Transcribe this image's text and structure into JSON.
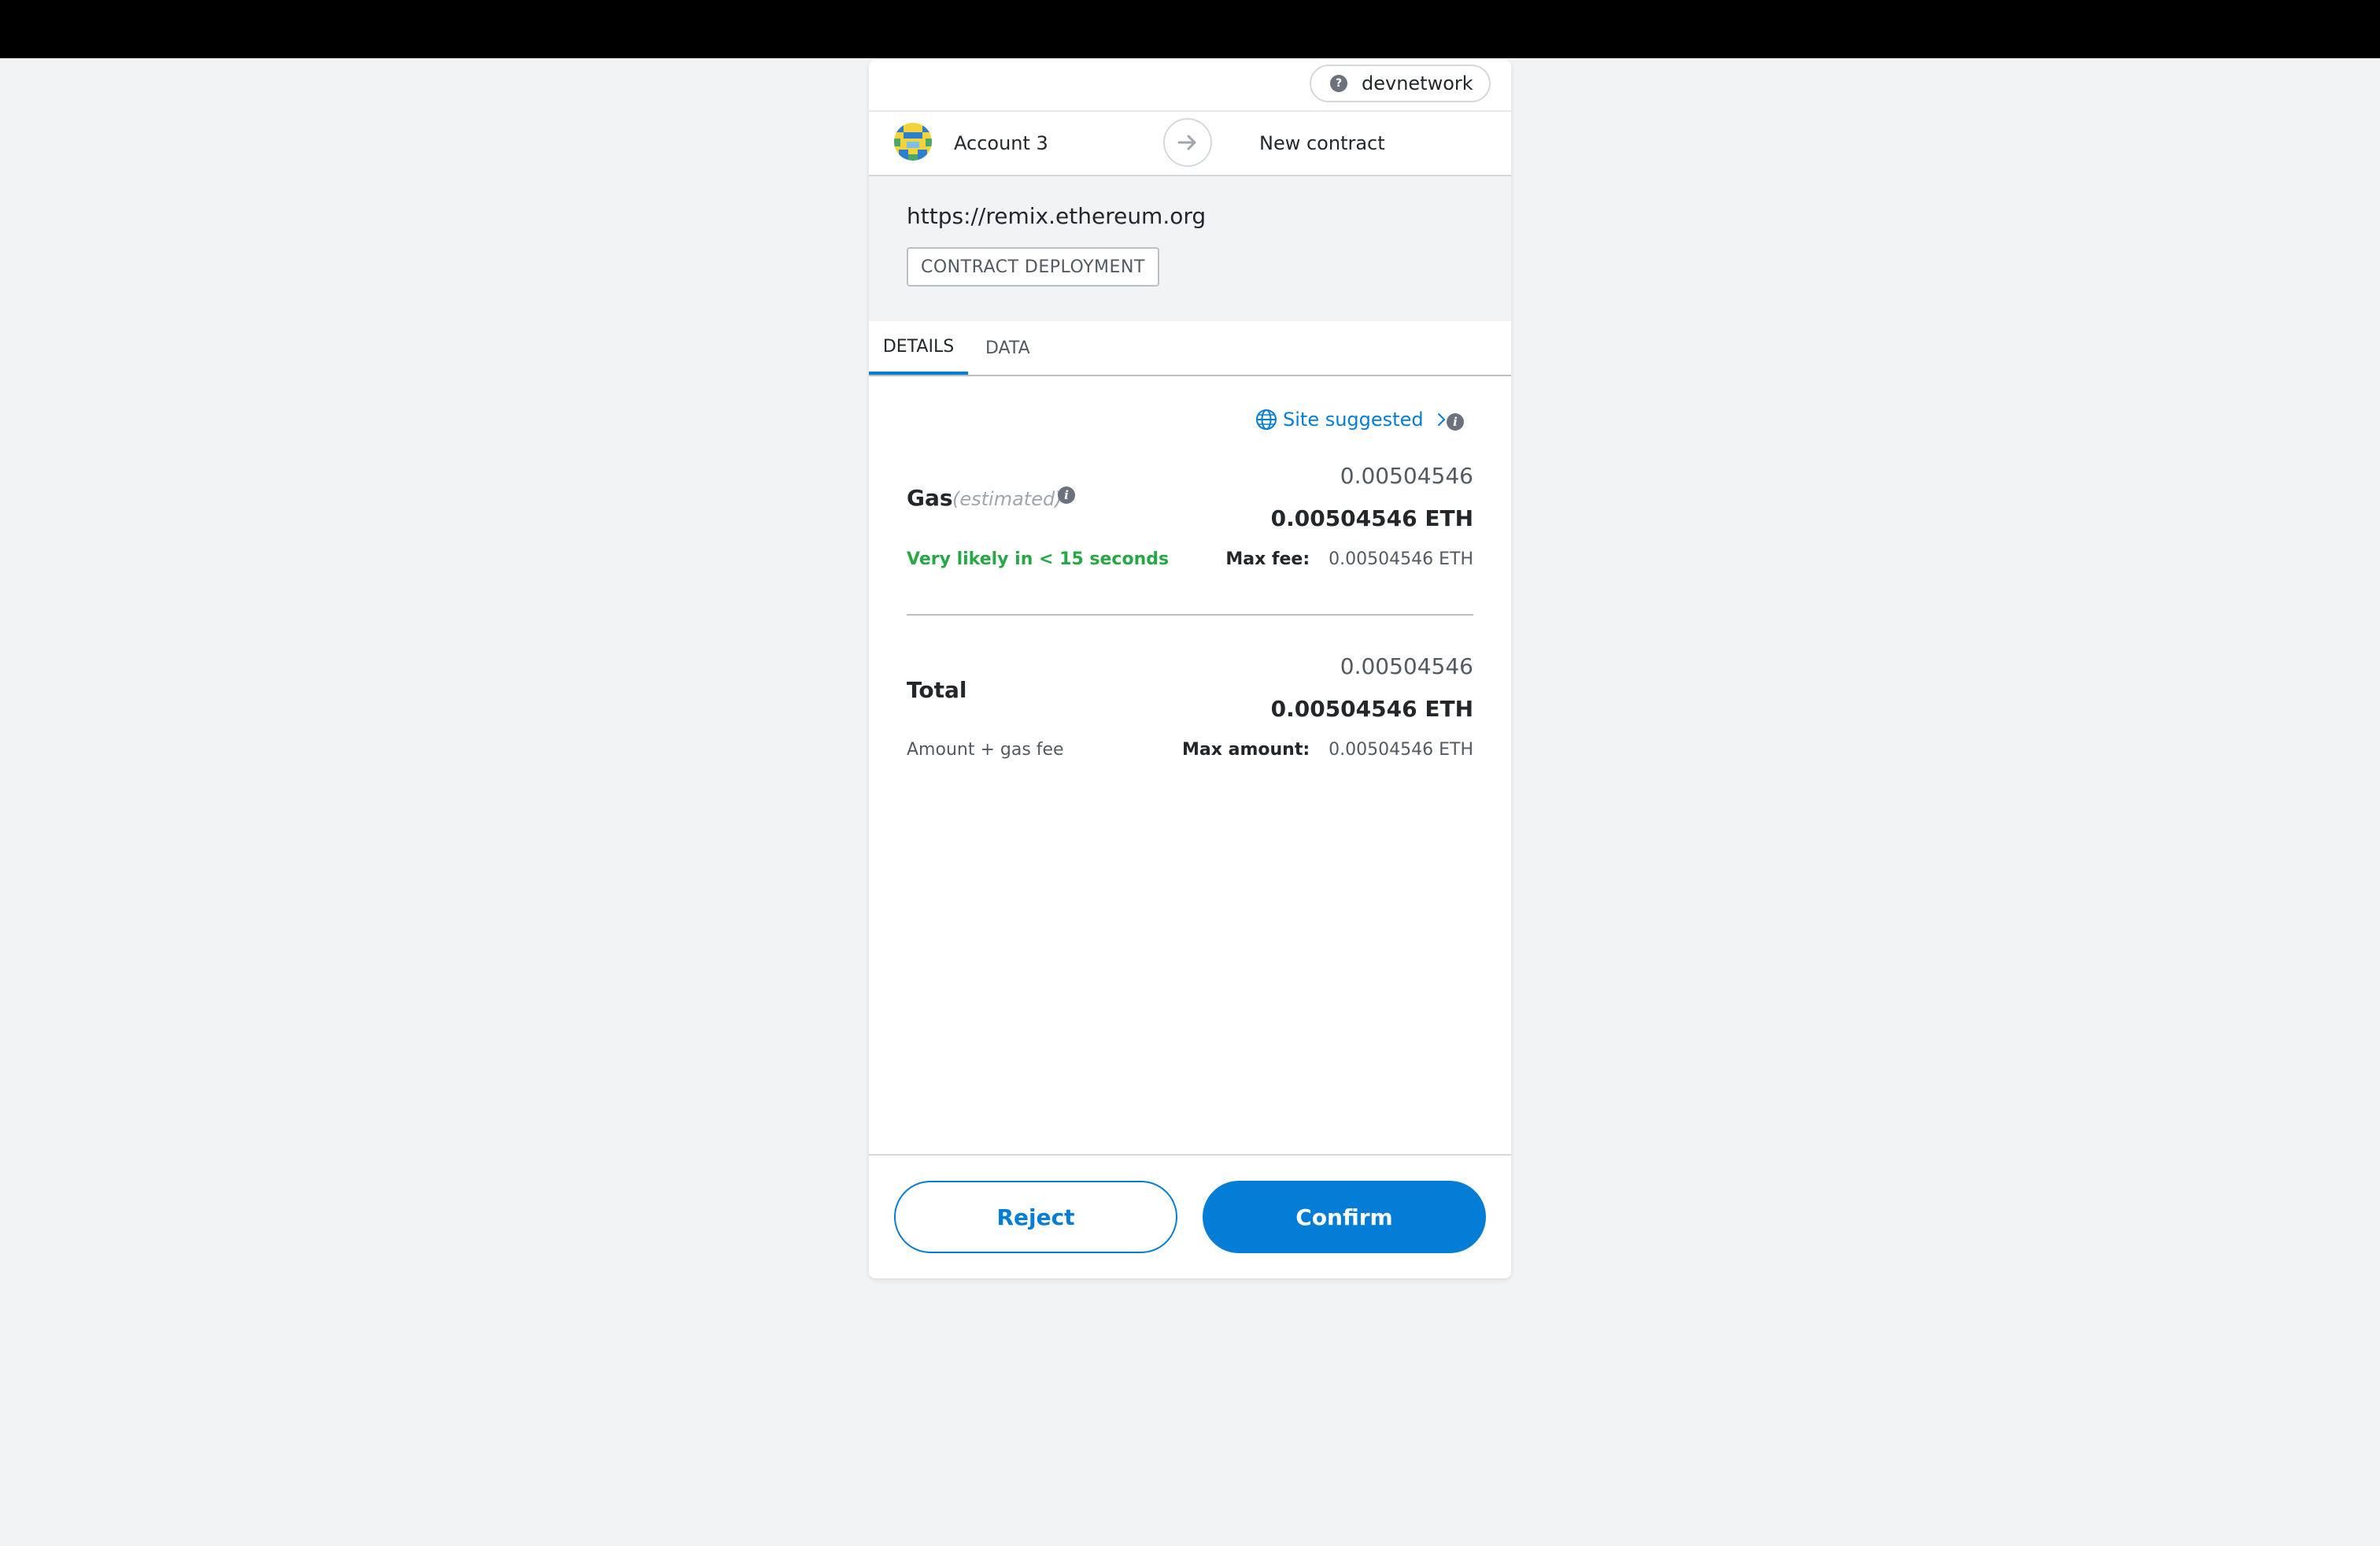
{
  "network": {
    "label": "devnetwork",
    "icon": "question-icon"
  },
  "sender": {
    "account_name": "Account 3",
    "avatar": "identicon"
  },
  "recipient": {
    "label": "New contract"
  },
  "origin": {
    "url": "https://remix.ethereum.org",
    "transaction_type": "CONTRACT DEPLOYMENT"
  },
  "tabs": [
    {
      "label": "DETAILS",
      "active": true
    },
    {
      "label": "DATA",
      "active": false
    }
  ],
  "gas_source": {
    "label": "Site suggested",
    "icon": "globe-icon"
  },
  "gas": {
    "label": "Gas",
    "qualifier": "(estimated)",
    "value_secondary": "0.00504546",
    "value_primary": "0.00504546 ETH",
    "timing": "Very likely in < 15 seconds",
    "max_fee_label": "Max fee:",
    "max_fee_value": "0.00504546 ETH"
  },
  "total": {
    "label": "Total",
    "value_secondary": "0.00504546",
    "value_primary": "0.00504546 ETH",
    "subtitle": "Amount + gas fee",
    "max_amount_label": "Max amount:",
    "max_amount_value": "0.00504546 ETH"
  },
  "actions": {
    "reject_label": "Reject",
    "confirm_label": "Confirm"
  },
  "colors": {
    "primary": "#037dd6",
    "success": "#28a745",
    "background": "#f2f3f4",
    "topbar": "#000000"
  }
}
